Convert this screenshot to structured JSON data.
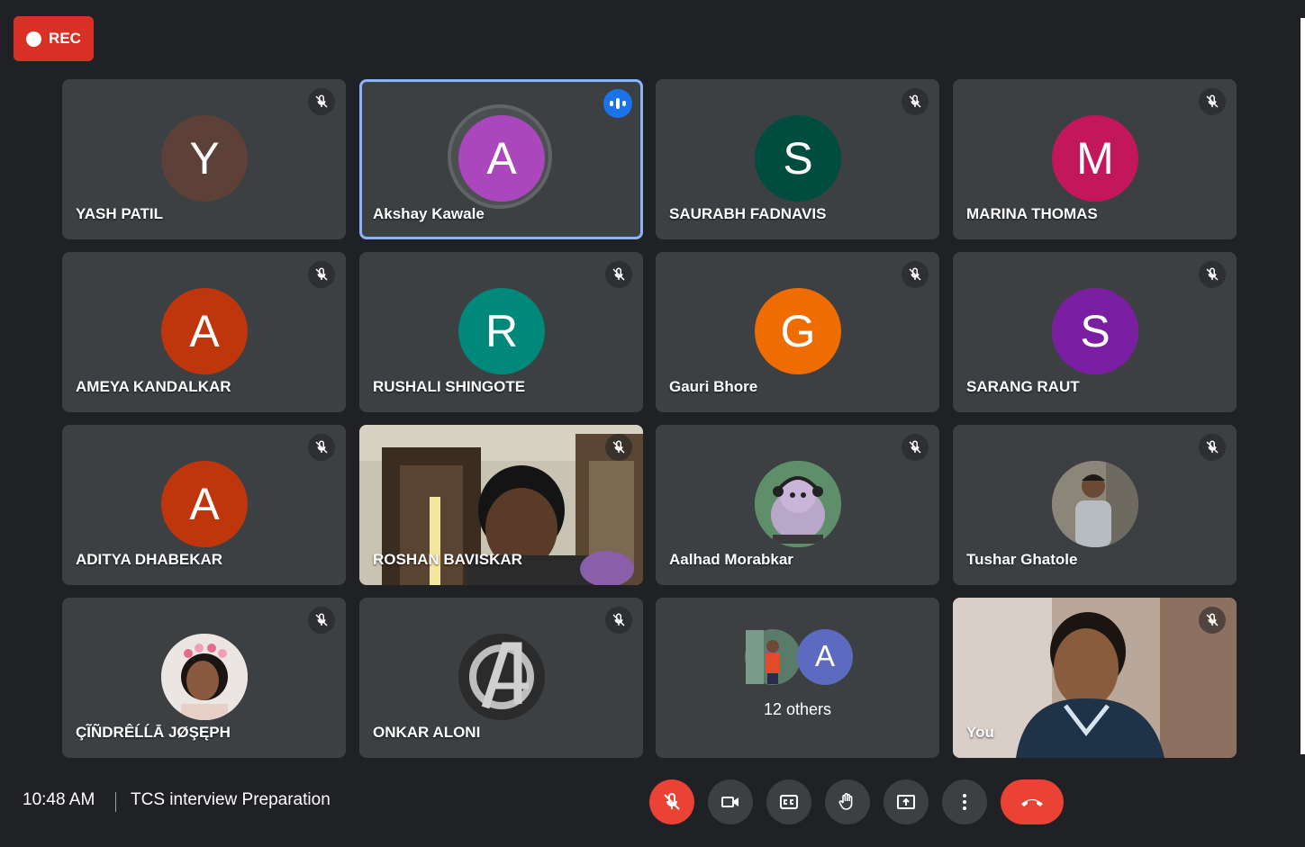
{
  "recording": {
    "label": "REC"
  },
  "participants": [
    {
      "name": "YASH PATIL",
      "initial": "Y",
      "color": "#5d4037",
      "muted": true
    },
    {
      "name": "Akshay Kawale",
      "initial": "A",
      "color": "#ab47bc",
      "speaking": true
    },
    {
      "name": "SAURABH FADNAVIS",
      "initial": "S",
      "color": "#004d40",
      "muted": true
    },
    {
      "name": "MARINA THOMAS",
      "initial": "M",
      "color": "#c2185b",
      "muted": true
    },
    {
      "name": "AMEYA KANDALKAR",
      "initial": "A",
      "color": "#bf360c",
      "muted": true
    },
    {
      "name": "RUSHALI SHINGOTE",
      "initial": "R",
      "color": "#00897b",
      "muted": true
    },
    {
      "name": "Gauri Bhore",
      "initial": "G",
      "color": "#ef6c00",
      "muted": true
    },
    {
      "name": "SARANG RAUT",
      "initial": "S",
      "color": "#7b1fa2",
      "muted": true
    },
    {
      "name": "ADITYA DHABEKAR",
      "initial": "A",
      "color": "#bf360c",
      "muted": true
    },
    {
      "name": "ROSHAN BAVISKAR",
      "video": true,
      "muted": true
    },
    {
      "name": "Aalhad Morabkar",
      "photo": "cartoon-cat-avatar",
      "muted": true
    },
    {
      "name": "Tushar Ghatole",
      "photo": "person-avatar",
      "muted": true
    },
    {
      "name": "ÇĨÑDRÊĹĹĀ JØŞĘPH",
      "photo": "person-avatar",
      "muted": true
    },
    {
      "name": "ONKAR ALONI",
      "photo": "avengers-logo-avatar",
      "muted": true
    }
  ],
  "others": {
    "label": "12 others",
    "initial": "A",
    "color": "#5c6bc0"
  },
  "self": {
    "name": "You",
    "video": true,
    "muted": true
  },
  "footer": {
    "time": "10:48 AM",
    "meeting_title": "TCS interview Preparation"
  },
  "controls": [
    {
      "icon": "mic-off-icon",
      "state": "off"
    },
    {
      "icon": "camera-icon"
    },
    {
      "icon": "captions-icon"
    },
    {
      "icon": "raise-hand-icon"
    },
    {
      "icon": "present-screen-icon"
    },
    {
      "icon": "more-options-icon"
    },
    {
      "icon": "leave-call-icon"
    }
  ],
  "colors": {
    "background": "#202124",
    "tile": "#3c4043",
    "accent": "#8ab4f8",
    "danger": "#ea4335",
    "speaking": "#1a73e8"
  }
}
